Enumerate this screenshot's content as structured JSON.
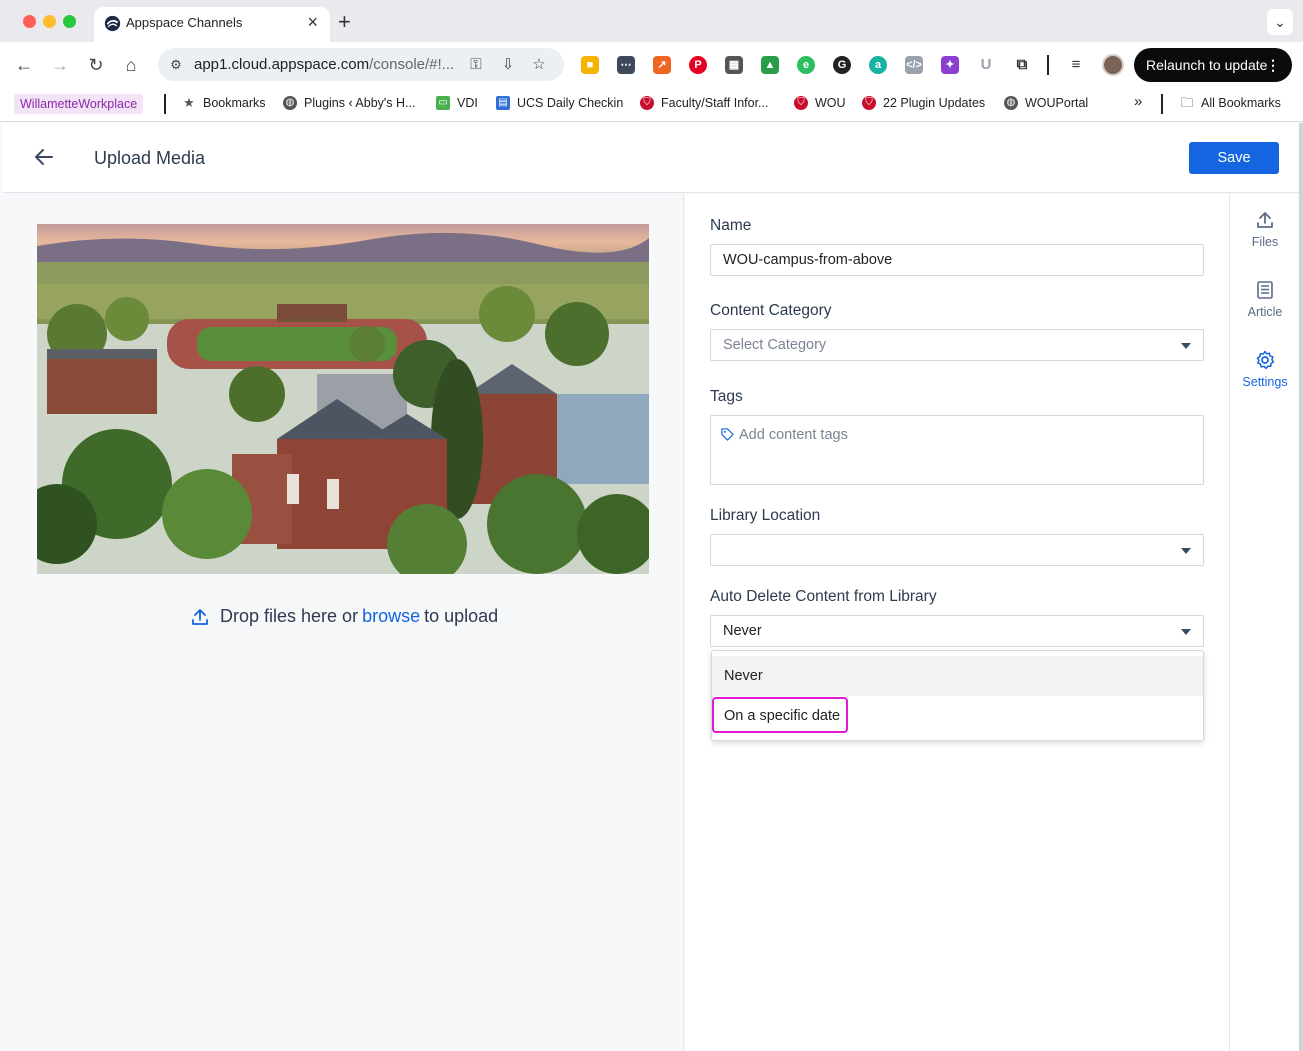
{
  "browser": {
    "tab_title": "Appspace Channels",
    "url_main": "app1.cloud.appspace.com",
    "url_path": "/console/#!...",
    "relaunch_label": "Relaunch to update",
    "bookmarks": [
      {
        "label": "WillametteWorkplace"
      },
      {
        "label": "Bookmarks",
        "icon": "star-icon"
      },
      {
        "label": "Plugins ‹ Abby's H...",
        "icon": "globe-icon"
      },
      {
        "label": "VDI",
        "icon": "monitor-icon"
      },
      {
        "label": "UCS Daily Checkin",
        "icon": "calendar-icon"
      },
      {
        "label": "Faculty/Staff Infor...",
        "icon": "wou-shield-icon"
      },
      {
        "label": "WOU",
        "icon": "wou-shield-icon"
      },
      {
        "label": "22 Plugin Updates",
        "icon": "wou-shield-icon"
      },
      {
        "label": "WOUPortal",
        "icon": "globe-icon"
      }
    ],
    "more_bookmarks": "»",
    "all_bookmarks": "All Bookmarks",
    "colors": {
      "accent": "#1565e0",
      "highlight": "#e21bd2"
    }
  },
  "header": {
    "title": "Upload Media",
    "save_label": "Save"
  },
  "left": {
    "drop_prefix": "Drop files here or",
    "browse_label": "browse",
    "drop_suffix": "to upload",
    "image_alt": "Aerial view of campus"
  },
  "form": {
    "name_label": "Name",
    "name_value": "WOU-campus-from-above",
    "category_label": "Content Category",
    "category_placeholder": "Select Category",
    "tags_label": "Tags",
    "tags_placeholder": "Add content tags",
    "library_label": "Library Location",
    "library_value": "",
    "autodelete_label": "Auto Delete Content from Library",
    "autodelete_value": "Never",
    "autodelete_options": [
      "Never",
      "On a specific date"
    ]
  },
  "rail": {
    "items": [
      {
        "label": "Files",
        "icon": "upload-icon"
      },
      {
        "label": "Article",
        "icon": "article-icon"
      },
      {
        "label": "Settings",
        "icon": "gear-icon",
        "active": true
      }
    ]
  }
}
